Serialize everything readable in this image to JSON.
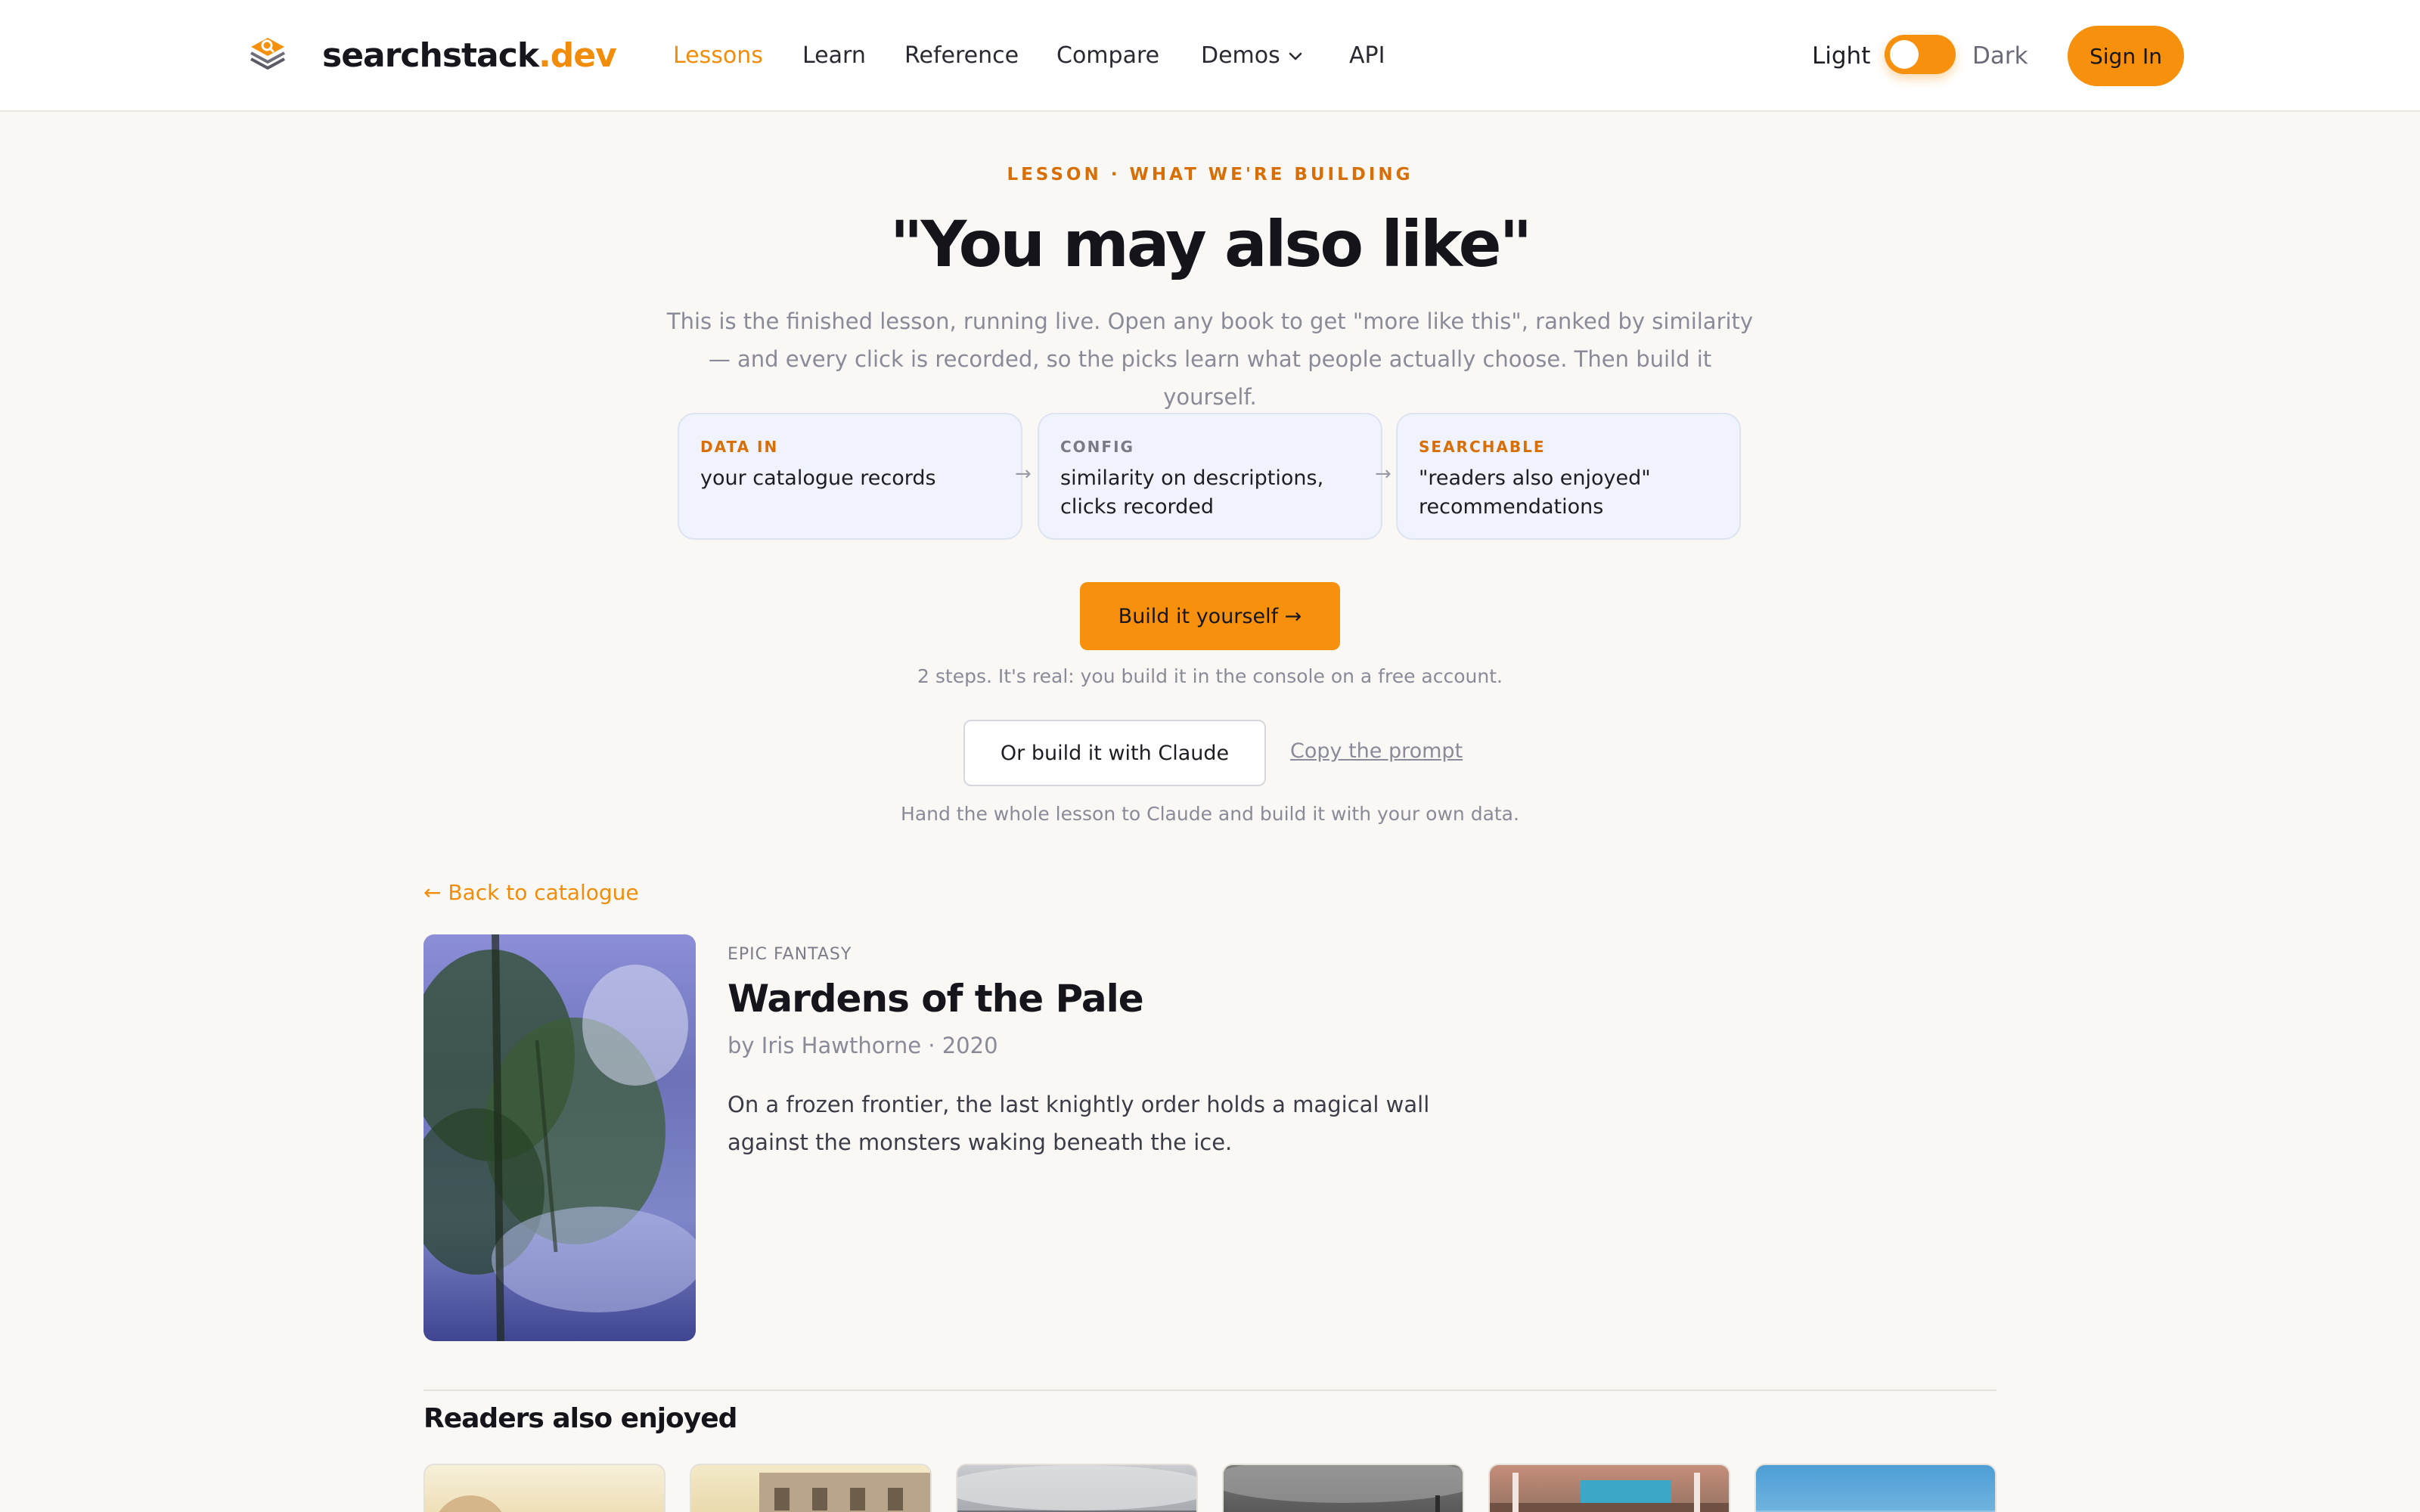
{
  "header": {
    "brand_main": "searchstack",
    "brand_tld": ".dev",
    "nav": [
      "Lessons",
      "Learn",
      "Reference",
      "Compare",
      "Demos",
      "API"
    ],
    "active_nav": "Lessons",
    "theme_light": "Light",
    "theme_dark": "Dark",
    "signin_label": "Sign In",
    "icons": {
      "logo": "layers-search-icon",
      "demos_dropdown": "chevron-down-icon"
    },
    "accent_color": "#f7900c"
  },
  "hero": {
    "eyebrow": "LESSON · WHAT WE'RE BUILDING",
    "title": "\"You may also like\"",
    "lede": "This is the finished lesson, running live. Open any book to get \"more like this\", ranked by similarity — and every click is recorded, so the picks learn what people actually choose. Then build it yourself.",
    "steps": [
      {
        "label": "DATA IN",
        "text": "your catalogue records"
      },
      {
        "label": "CONFIG",
        "text": "similarity on descriptions, clicks recorded"
      },
      {
        "label": "SEARCHABLE",
        "text": "\"readers also enjoyed\" recommendations"
      }
    ],
    "step_arrow": "→",
    "cta_label": "Build it yourself →",
    "cta_note": "2 steps. It's real: you build it in the console on a free account.",
    "claude_button": "Or build it with Claude",
    "copy_prompt": "Copy the prompt",
    "claude_note": "Hand the whole lesson to Claude and build it with your own data."
  },
  "book": {
    "back_link": "← Back to catalogue",
    "genre": "EPIC FANTASY",
    "title": "Wardens of the Pale",
    "byline": "by Iris Hawthorne · 2020",
    "synopsis": "On a frozen frontier, the last knightly order holds a magical wall against the monsters waking beneath the ice."
  },
  "recommendations": {
    "heading": "Readers also enjoyed",
    "card_count": 6
  }
}
